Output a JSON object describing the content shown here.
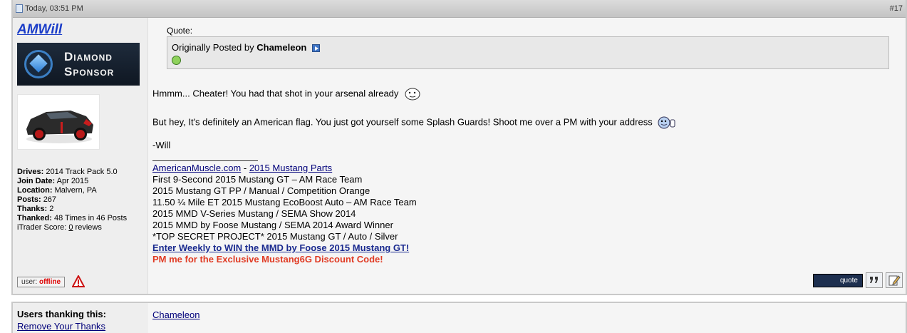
{
  "post": {
    "date": "Today, 03:51 PM",
    "number": "#17"
  },
  "user": {
    "name": "AMWill",
    "sponsor_line1": "Diamond",
    "sponsor_line2": "Sponsor",
    "details": {
      "drives_label": "Drives:",
      "drives": "2014 Track Pack 5.0",
      "join_label": "Join Date:",
      "join": "Apr 2015",
      "location_label": "Location:",
      "location": "Malvern, PA",
      "posts_label": "Posts:",
      "posts": "267",
      "thanks_label": "Thanks:",
      "thanks": "2",
      "thanked_label": "Thanked:",
      "thanked": "48 Times in 46 Posts",
      "itrader_label": "iTrader Score:",
      "itrader_count": "0",
      "itrader_suffix": "reviews"
    },
    "status_prefix": "user:",
    "status_value": "offline"
  },
  "quote": {
    "label": "Quote:",
    "originally": "Originally Posted by",
    "author": "Chameleon"
  },
  "message": {
    "line1": "Hmmm... Cheater! You had that shot in your arsenal already",
    "line2": "But hey, It's definitely an American flag. You just got yourself some Splash Guards! Shoot me over a PM with your address",
    "line3": "-Will"
  },
  "signature": {
    "site_link": "AmericanMuscle.com",
    "dash": " - ",
    "parts_link": "2015 Mustang Parts",
    "lines": [
      "First 9-Second 2015 Mustang GT – AM Race Team",
      "2015 Mustang GT PP / Manual / Competition Orange",
      "11.50 ¼ Mile ET 2015 Mustang EcoBoost Auto – AM Race Team",
      "2015 MMD V-Series Mustang / SEMA Show 2014",
      "2015 MMD by Foose Mustang / SEMA 2014 Award Winner",
      "*TOP SECRET PROJECT* 2015 Mustang GT / Auto / Silver"
    ],
    "contest": "Enter Weekly to WIN the MMD by Foose 2015 Mustang GT!",
    "discount": "PM me for the Exclusive Mustang6G Discount Code!"
  },
  "actions": {
    "quote_label": "quote"
  },
  "thanks": {
    "title": "Users thanking this:",
    "remove": "Remove Your Thanks",
    "user": "Chameleon"
  },
  "colors": {
    "username": "#1a3cc8",
    "contest": "#1a2a8f",
    "discount": "#e03b24",
    "offline": "#dd0000"
  }
}
